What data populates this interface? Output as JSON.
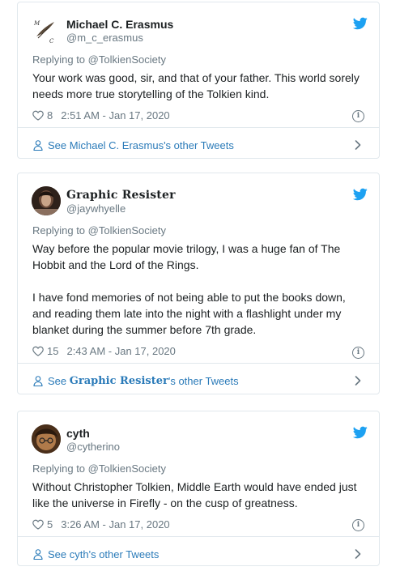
{
  "tweets": [
    {
      "display_name": "Michael C. Erasmus",
      "handle": "@m_c_erasmus",
      "replying_to": "Replying to @TolkienSociety",
      "text": "Your work was good, sir, and that of your father. This world sorely needs more true storytelling of the Tolkien kind.",
      "likes": "8",
      "timestamp": "2:51 AM - Jan 17, 2020",
      "footer_prefix": "See ",
      "footer_name": "Michael C. Erasmus",
      "footer_suffix": "'s other Tweets",
      "avatar_monogram_top": "M",
      "avatar_monogram_bottom": "C"
    },
    {
      "display_name": "Graphic Resister",
      "handle": "@jaywhyelle",
      "replying_to": "Replying to @TolkienSociety",
      "text": "Way before the popular movie trilogy, I was a huge fan of The Hobbit and the Lord of the Rings.\n\nI have fond memories of not being able to put the books down, and reading them late into the night with a flashlight under my blanket during the summer before 7th grade.",
      "likes": "15",
      "timestamp": "2:43 AM - Jan 17, 2020",
      "footer_prefix": "See ",
      "footer_name": "Graphic Resister",
      "footer_suffix": "'s other Tweets"
    },
    {
      "display_name": "cyth",
      "handle": "@cytherino",
      "replying_to": "Replying to @TolkienSociety",
      "text": "Without Christopher Tolkien, Middle Earth would have ended just like the universe in Firefly - on the cusp of greatness.",
      "likes": "5",
      "timestamp": "3:26 AM - Jan 17, 2020",
      "footer_prefix": "See ",
      "footer_name": "cyth",
      "footer_suffix": "'s other Tweets"
    }
  ],
  "colors": {
    "twitter_blue": "#1da1f2",
    "link_blue": "#2b7bb9",
    "secondary_text": "#697882",
    "border": "#e1e8ed"
  },
  "icons": [
    "twitter-bird-icon",
    "heart-icon",
    "info-icon",
    "person-icon",
    "chevron-right-icon"
  ]
}
